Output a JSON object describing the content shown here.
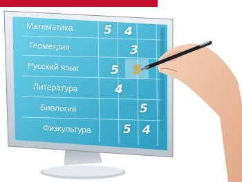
{
  "header": {
    "accent_color": "#c8102e"
  },
  "subjects": [
    {
      "name": "Математика",
      "grades": [
        "5",
        "4"
      ]
    },
    {
      "name": "Геометрия",
      "grades": [
        "3"
      ]
    },
    {
      "name": "Русский язык",
      "grades": [
        "5",
        "5"
      ]
    },
    {
      "name": "Литература",
      "grades": [
        "4"
      ]
    },
    {
      "name": "Биология",
      "grades": [
        "5"
      ]
    },
    {
      "name": "Физкультура",
      "grades": [
        "5",
        "4"
      ]
    }
  ],
  "colors": {
    "screen": "#4fc3dc",
    "highlight_grade": "#f5a623"
  }
}
